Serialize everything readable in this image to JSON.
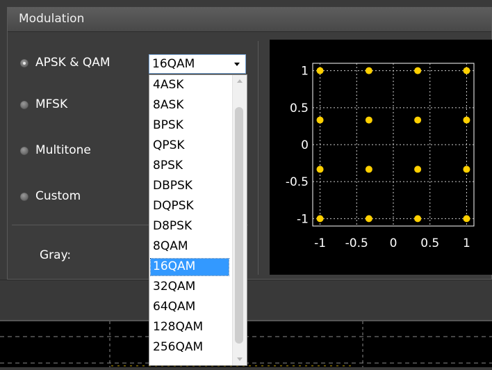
{
  "panel": {
    "title": "Modulation"
  },
  "modulation_options": [
    {
      "label": "APSK & QAM",
      "selected": true
    },
    {
      "label": "MFSK",
      "selected": false
    },
    {
      "label": "Multitone",
      "selected": false
    },
    {
      "label": "Custom",
      "selected": false
    }
  ],
  "gray_label": "Gray:",
  "combo": {
    "value": "16QAM",
    "options": [
      "4ASK",
      "8ASK",
      "BPSK",
      "QPSK",
      "8PSK",
      "DBPSK",
      "DQPSK",
      "D8PSK",
      "8QAM",
      "16QAM",
      "32QAM",
      "64QAM",
      "128QAM",
      "256QAM"
    ],
    "selected_index": 9
  },
  "chart_data": {
    "type": "scatter",
    "x_ticks": [
      "-1",
      "-0.5",
      "0",
      "0.5",
      "1"
    ],
    "y_ticks": [
      "1",
      "0.5",
      "0",
      "-0.5",
      "-1"
    ],
    "xlim": [
      -1.1,
      1.1
    ],
    "ylim": [
      -1.1,
      1.1
    ],
    "grid": true,
    "point_color": "#ffd000",
    "points": [
      [
        -1,
        1
      ],
      [
        -0.333,
        1
      ],
      [
        0.333,
        1
      ],
      [
        1,
        1
      ],
      [
        -1,
        0.333
      ],
      [
        -0.333,
        0.333
      ],
      [
        0.333,
        0.333
      ],
      [
        1,
        0.333
      ],
      [
        -1,
        -0.333
      ],
      [
        -0.333,
        -0.333
      ],
      [
        0.333,
        -0.333
      ],
      [
        1,
        -0.333
      ],
      [
        -1,
        -1
      ],
      [
        -0.333,
        -1
      ],
      [
        0.333,
        -1
      ],
      [
        1,
        -1
      ]
    ]
  }
}
